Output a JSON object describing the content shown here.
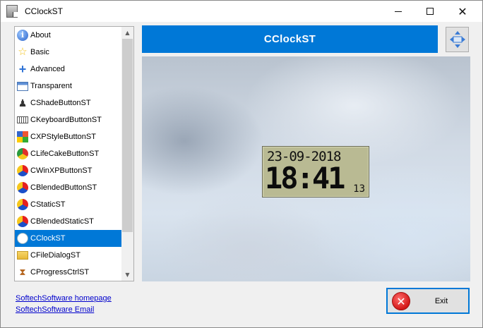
{
  "window": {
    "title": "CClockST",
    "controls": {
      "minimize": "—",
      "maximize": "☐",
      "close": "✕"
    }
  },
  "sidebar": {
    "items": [
      {
        "label": "About",
        "icon": "info-icon"
      },
      {
        "label": "Basic",
        "icon": "star-icon"
      },
      {
        "label": "Advanced",
        "icon": "plus-icon"
      },
      {
        "label": "Transparent",
        "icon": "window-icon"
      },
      {
        "label": "CShadeButtonST",
        "icon": "shade-person-icon"
      },
      {
        "label": "CKeyboardButtonST",
        "icon": "keyboard-icon"
      },
      {
        "label": "CXPStyleButtonST",
        "icon": "xp-style-icon"
      },
      {
        "label": "CLifeCakeButtonST",
        "icon": "chrome-like-icon"
      },
      {
        "label": "CWinXPButtonST",
        "icon": "colorball-icon"
      },
      {
        "label": "CBlendedButtonST",
        "icon": "colorball-icon"
      },
      {
        "label": "CStaticST",
        "icon": "colorball-icon"
      },
      {
        "label": "CBlendedStaticST",
        "icon": "colorball-icon"
      },
      {
        "label": "CClockST",
        "icon": "clock-icon",
        "selected": true
      },
      {
        "label": "CFileDialogST",
        "icon": "folder-icon"
      },
      {
        "label": "CProgressCtrlST",
        "icon": "hourglass-icon"
      }
    ]
  },
  "main": {
    "header_title": "CClockST",
    "move_button_icon": "move-arrows-icon",
    "clock": {
      "date": "23-09-2018",
      "time": "18:41",
      "seconds": "13"
    }
  },
  "footer": {
    "homepage_link": "SoftechSoftware homepage",
    "email_link": "SoftechSoftware Email",
    "exit_label": "Exit"
  },
  "colors": {
    "accent": "#0078d7",
    "lcd_background": "#b9ba93",
    "exit_icon": "#d31818",
    "link": "#0000cc"
  }
}
